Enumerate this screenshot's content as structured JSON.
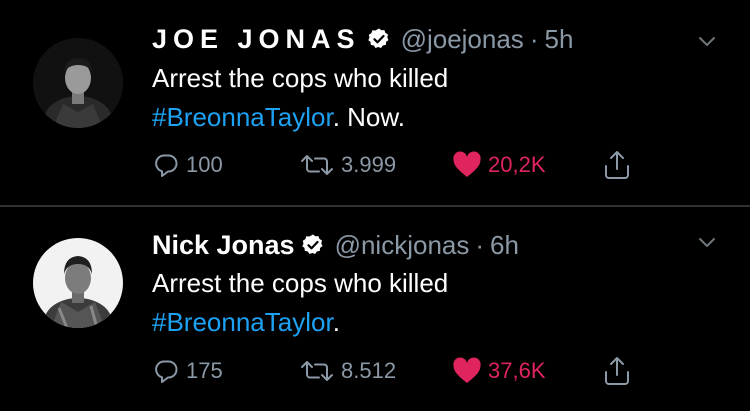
{
  "tweets": [
    {
      "name": "JOE JONAS",
      "handle": "@joejonas",
      "time": "5h",
      "text_before": "Arrest the cops who killed",
      "hashtag": "#BreonnaTaylor",
      "text_after": ". Now.",
      "replies": "100",
      "retweets": "3.999",
      "likes": "20,2K"
    },
    {
      "name": "Nick Jonas",
      "handle": "@nickjonas",
      "time": "6h",
      "text_before": "Arrest the cops who killed",
      "hashtag": "#BreonnaTaylor",
      "text_after": ".",
      "replies": "175",
      "retweets": "8.512",
      "likes": "37,6K"
    }
  ],
  "separator": "·",
  "colors": {
    "background": "#000000",
    "hashtag": "#1da1f2",
    "like": "#e0245e",
    "muted": "#8b98a5"
  },
  "icons": [
    "verified-badge-icon",
    "chevron-down-icon",
    "reply-icon",
    "retweet-icon",
    "heart-icon",
    "share-icon"
  ]
}
